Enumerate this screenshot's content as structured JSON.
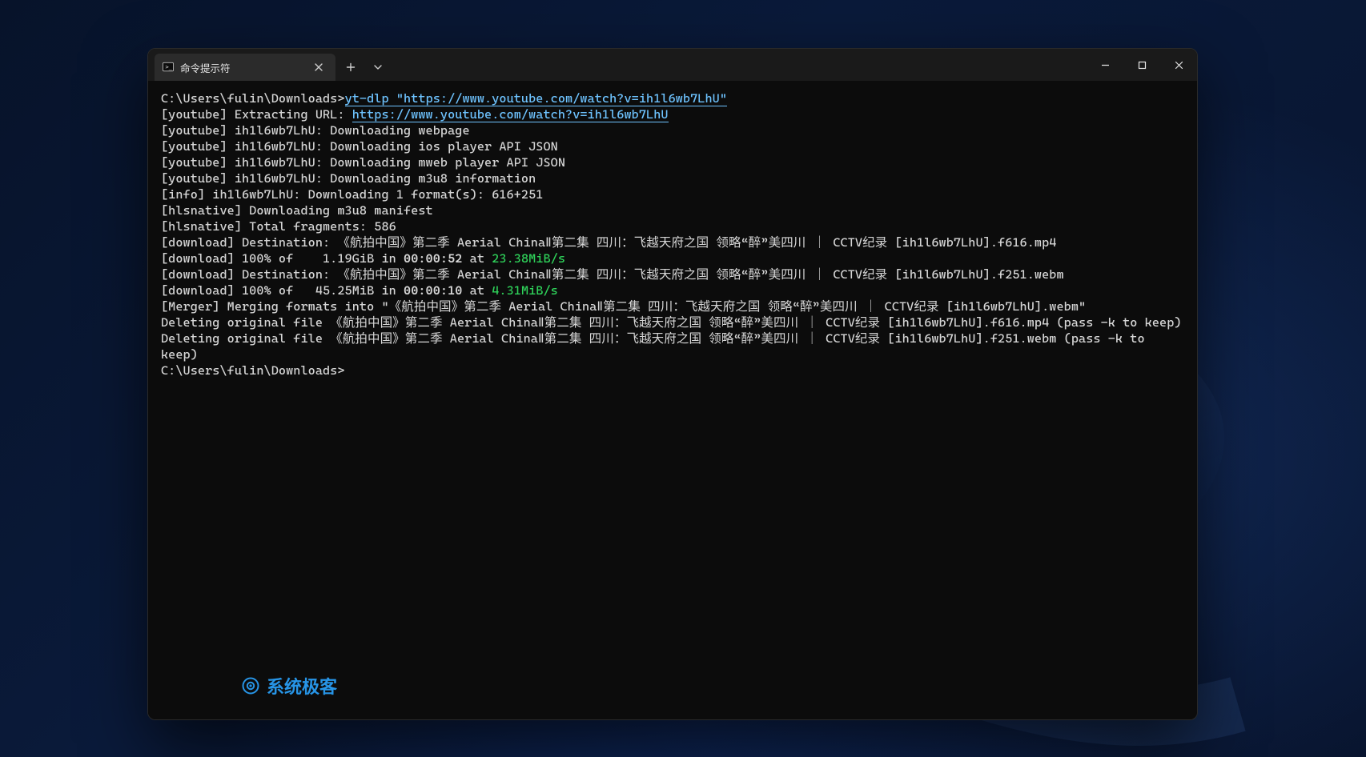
{
  "tab": {
    "icon_name": "cmd-app-icon",
    "title": "命令提示符"
  },
  "prompt_path": "C:\\Users\\fulin\\Downloads>",
  "typed_command": "yt-dlp \"https://www.youtube.com/watch?v=ih1l6wb7LhU\"",
  "lines": [
    {
      "type": "text",
      "text": "[youtube] Extracting URL: "
    },
    {
      "type": "url",
      "text": "https://www.youtube.com/watch?v=ih1l6wb7LhU",
      "inline_after": 0
    },
    {
      "type": "text",
      "text": "[youtube] ih1l6wb7LhU: Downloading webpage"
    },
    {
      "type": "text",
      "text": "[youtube] ih1l6wb7LhU: Downloading ios player API JSON"
    },
    {
      "type": "text",
      "text": "[youtube] ih1l6wb7LhU: Downloading mweb player API JSON"
    },
    {
      "type": "text",
      "text": "[youtube] ih1l6wb7LhU: Downloading m3u8 information"
    },
    {
      "type": "text",
      "text": "[info] ih1l6wb7LhU: Downloading 1 format(s): 616+251"
    },
    {
      "type": "text",
      "text": "[hlsnative] Downloading m3u8 manifest"
    },
    {
      "type": "text",
      "text": "[hlsnative] Total fragments: 586"
    },
    {
      "type": "text",
      "text": "[download] Destination: 《航拍中国》第二季 Aerial ChinaⅡ第二集 四川：飞越天府之国 领略“醉”美四川 ｜ CCTV纪录 [ih1l6wb7LhU].f616.mp4"
    },
    {
      "type": "progress",
      "prefix": "[download] 100% of    1.19GiB in ",
      "time": "00:00:52",
      "mid": " at ",
      "rate": "23.38MiB/s"
    },
    {
      "type": "text",
      "text": "[download] Destination: 《航拍中国》第二季 Aerial ChinaⅡ第二集 四川：飞越天府之国 领略“醉”美四川 ｜ CCTV纪录 [ih1l6wb7LhU].f251.webm"
    },
    {
      "type": "progress",
      "prefix": "[download] 100% of   45.25MiB in ",
      "time": "00:00:10",
      "mid": " at ",
      "rate": "4.31MiB/s"
    },
    {
      "type": "text",
      "text": "[Merger] Merging formats into \"《航拍中国》第二季 Aerial ChinaⅡ第二集 四川：飞越天府之国 领略“醉”美四川 ｜ CCTV纪录 [ih1l6wb7LhU].webm\""
    },
    {
      "type": "text",
      "text": "Deleting original file 《航拍中国》第二季 Aerial ChinaⅡ第二集 四川：飞越天府之国 领略“醉”美四川 ｜ CCTV纪录 [ih1l6wb7LhU].f616.mp4 (pass -k to keep)"
    },
    {
      "type": "text",
      "text": "Deleting original file 《航拍中国》第二季 Aerial ChinaⅡ第二集 四川：飞越天府之国 领略“醉”美四川 ｜ CCTV纪录 [ih1l6wb7LhU].f251.webm (pass -k to keep)"
    },
    {
      "type": "blank"
    }
  ],
  "final_prompt": "C:\\Users\\fulin\\Downloads>",
  "watermark": {
    "text": "系统极客",
    "accent": "#2aa4ff"
  },
  "window_controls": {
    "minimize_title": "Minimize",
    "maximize_title": "Maximize",
    "close_title": "Close"
  },
  "tabstrip": {
    "new_tab_title": "New tab",
    "tabs_menu_title": "Tab menu",
    "close_tab_title": "Close tab"
  }
}
